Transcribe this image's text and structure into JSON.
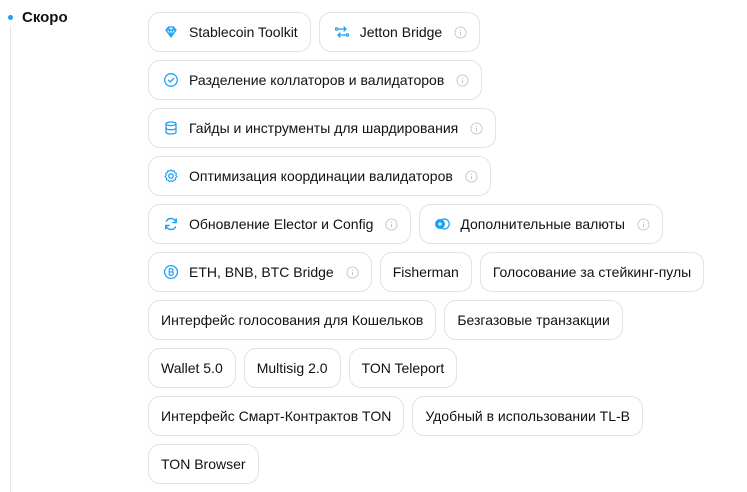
{
  "section": {
    "title": "Скоро"
  },
  "accent_color": "#1ea1f2",
  "chips": {
    "stablecoin": {
      "label": "Stablecoin Toolkit",
      "icon": "diamond-icon"
    },
    "jetton_bridge": {
      "label": "Jetton Bridge",
      "icon": "bridge-icon"
    },
    "collators": {
      "label": "Разделение коллаторов и валидаторов",
      "icon": "check-circle-icon"
    },
    "sharding": {
      "label": "Гайды и инструменты для шардирования",
      "icon": "database-icon"
    },
    "coordination": {
      "label": "Оптимизация координации валидаторов",
      "icon": "gear-icon"
    },
    "elector": {
      "label": "Обновление Elector и Config",
      "icon": "refresh-icon"
    },
    "currencies": {
      "label": "Дополнительные валюты",
      "icon": "coins-icon"
    },
    "btc_bridge": {
      "label": "ETH, BNB, BTC Bridge",
      "icon": "bitcoin-icon"
    },
    "fisherman": {
      "label": "Fisherman"
    },
    "staking_vote": {
      "label": "Голосование за стейкинг-пулы"
    },
    "wallet_vote": {
      "label": "Интерфейс голосования для Кошельков"
    },
    "gasless": {
      "label": "Безгазовые транзакции"
    },
    "wallet5": {
      "label": "Wallet 5.0"
    },
    "multisig": {
      "label": "Multisig 2.0"
    },
    "teleport": {
      "label": "TON Teleport"
    },
    "smart_contracts": {
      "label": "Интерфейс Смарт-Контрактов TON"
    },
    "tlb": {
      "label": "Удобный в использовании TL-B"
    },
    "browser": {
      "label": "TON Browser"
    }
  }
}
